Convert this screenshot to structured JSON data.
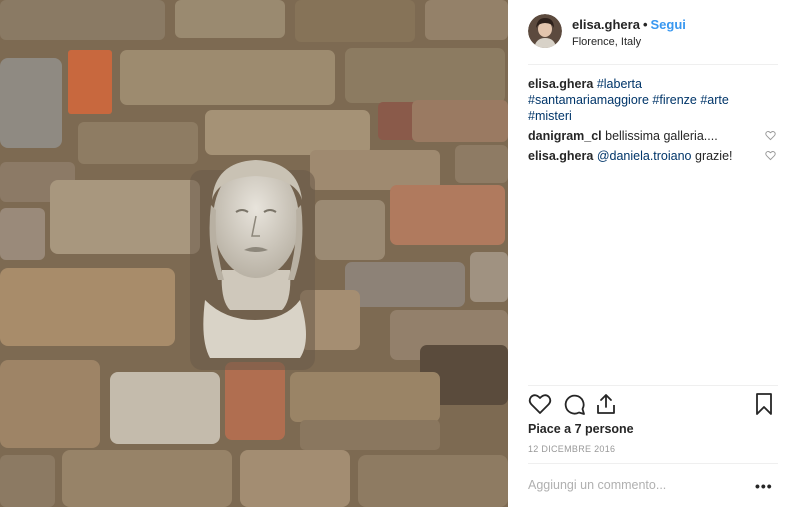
{
  "post": {
    "username": "elisa.ghera",
    "follow_label": "Segui",
    "location": "Florence, Italy",
    "caption": {
      "username": "elisa.ghera",
      "hashtags": [
        "#laberta",
        "#santamariamaggiore",
        "#firenze",
        "#arte",
        "#misteri"
      ]
    },
    "comments": [
      {
        "username": "danigram_cl",
        "text": "bellissima galleria....",
        "mention": ""
      },
      {
        "username": "elisa.ghera",
        "mention": "@daniela.troiano",
        "text": " grazie!"
      }
    ],
    "likes": "Piace a 7 persone",
    "date": "12 DICEMBRE 2016",
    "add_comment_placeholder": "Aggiungi un commento...",
    "more_label": "•••"
  },
  "icons": {
    "like": "heart-icon",
    "comment": "comment-bubble-icon",
    "share": "share-icon",
    "save": "bookmark-icon",
    "small_like": "heart-small-icon"
  },
  "colors": {
    "accent": "#3897f0",
    "link": "#003569",
    "text": "#262626",
    "muted": "#999999"
  }
}
